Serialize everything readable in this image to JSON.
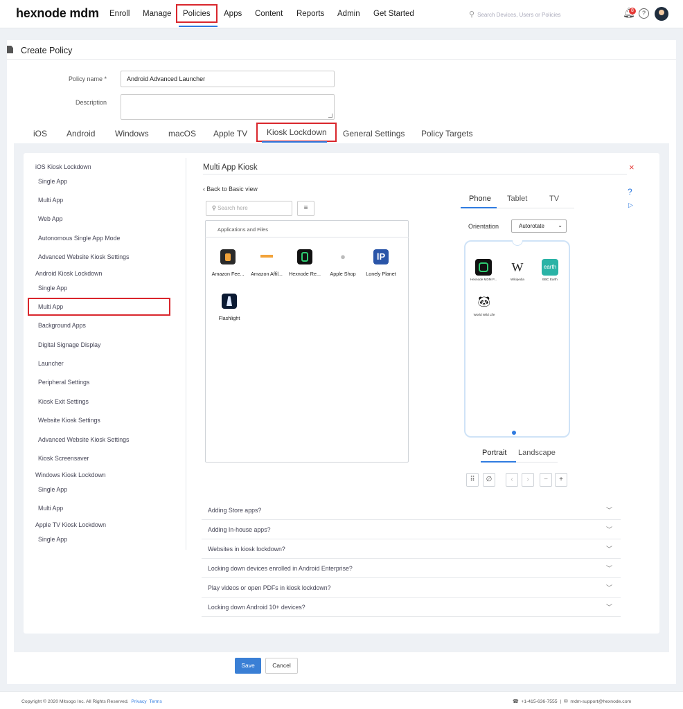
{
  "header": {
    "logo": "hexnode mdm",
    "nav": [
      "Enroll",
      "Manage",
      "Policies",
      "Apps",
      "Content",
      "Reports",
      "Admin",
      "Get Started"
    ],
    "search_placeholder": "Search Devices, Users or Policies",
    "notification_count": "8",
    "help_icon": "?"
  },
  "page": {
    "title": "Create Policy",
    "policy_name_label": "Policy name *",
    "policy_name_value": "Android Advanced Launcher",
    "description_label": "Description",
    "tabs": [
      "iOS",
      "Android",
      "Windows",
      "macOS",
      "Apple TV",
      "Kiosk Lockdown",
      "General Settings",
      "Policy Targets"
    ]
  },
  "sidebar": {
    "ios_header": "iOS Kiosk Lockdown",
    "ios_items": [
      "Single App",
      "Multi App",
      "Web App",
      "Autonomous Single App Mode",
      "Advanced Website Kiosk Settings"
    ],
    "android_header": "Android Kiosk Lockdown",
    "android_items": [
      "Single App",
      "Multi App",
      "Background Apps",
      "Digital Signage Display",
      "Launcher",
      "Peripheral Settings",
      "Kiosk Exit Settings",
      "Website Kiosk Settings",
      "Advanced Website Kiosk Settings",
      "Kiosk Screensaver"
    ],
    "windows_header": "Windows Kiosk Lockdown",
    "windows_items": [
      "Single App",
      "Multi App"
    ],
    "appletv_header": "Apple TV Kiosk Lockdown",
    "appletv_items": [
      "Single App"
    ]
  },
  "kiosk": {
    "title": "Multi App Kiosk",
    "close": "×",
    "back_link": "Back to Basic view",
    "search_placeholder": "Search here",
    "apps_header": "Applications and Files",
    "apps": [
      "Amazon Fee...",
      "Amazon Affil...",
      "Hexnode Re...",
      "Apple Shop",
      "Lonely Planet",
      "Flashlight"
    ],
    "device_tabs": [
      "Phone",
      "Tablet",
      "TV"
    ],
    "orientation_label": "Orientation",
    "orientation_value": "Autorotate",
    "phone_apps": [
      "Hexnode MDM P...",
      "Wikipedia",
      "BBC Earth",
      "World Wild Life"
    ],
    "orientation_tabs": [
      "Portrait",
      "Landscape"
    ],
    "help_q": "?",
    "help_play": "▷"
  },
  "faqs": [
    "Adding Store apps?",
    "Adding In-house apps?",
    "Websites in kiosk lockdown?",
    "Locking down devices enrolled in Android Enterprise?",
    "Play videos or open PDFs in kiosk lockdown?",
    "Locking down Android 10+ devices?"
  ],
  "buttons": {
    "save": "Save",
    "cancel": "Cancel"
  },
  "footer": {
    "copyright": "Copyright © 2020 Mitsogo Inc. All Rights Reserved.",
    "privacy": "Privacy",
    "terms": "Terms",
    "phone": "+1-415-636-7555",
    "email": "mdm-support@hexnode.com"
  },
  "colors": {
    "accent": "#2f7be0",
    "highlight_border": "#d9262c",
    "save_button": "#3a7fd5"
  }
}
